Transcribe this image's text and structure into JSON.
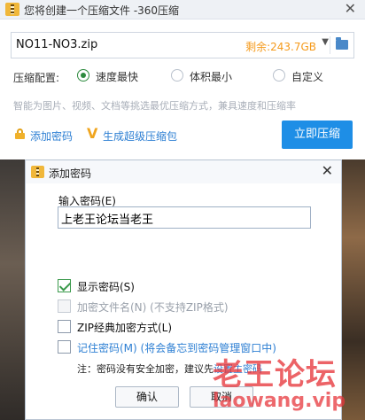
{
  "main_window": {
    "title": "您将创建一个压缩文件 -360压缩",
    "path": "NO11-NO3.zip",
    "free_space": "剩余:243.7GB",
    "config_label": "压缩配置:",
    "options": [
      {
        "label": "速度最快",
        "selected": true
      },
      {
        "label": "体积最小",
        "selected": false
      },
      {
        "label": "自定义",
        "selected": false
      }
    ],
    "hint": "智能为图片、视频、文档等挑选最优压缩方式，兼具速度和压缩率",
    "add_password_link": "添加密码",
    "super_pack_link": "生成超级压缩包",
    "compress_button": "立即压缩"
  },
  "password_dialog": {
    "title": "添加密码",
    "input_label": "输入密码(E)",
    "input_value": "上老王论坛当老王",
    "checkboxes": [
      {
        "label": "显示密码(S)",
        "checked": true,
        "disabled": false
      },
      {
        "label": "加密文件名(N) (不支持ZIP格式)",
        "checked": false,
        "disabled": true
      },
      {
        "label": "ZIP经典加密方式(L)",
        "checked": false,
        "disabled": false
      },
      {
        "label": "记住密码(M)",
        "label_extra": "(将会备忘到密码管理窗口中)",
        "checked": false,
        "disabled": false
      }
    ],
    "note_prefix": "注：密码没有安全加密，建议先",
    "note_link": "设置主密码",
    "ok_button": "确认",
    "cancel_button": "取消"
  },
  "watermark": {
    "text": "老王论坛",
    "url": "laowang.vip"
  },
  "colors": {
    "accent": "#1e8ee6",
    "link": "#2d7fd3",
    "free_space": "#f59a1b",
    "radio_selected": "#2d8a3e",
    "watermark": "#e7373c"
  }
}
